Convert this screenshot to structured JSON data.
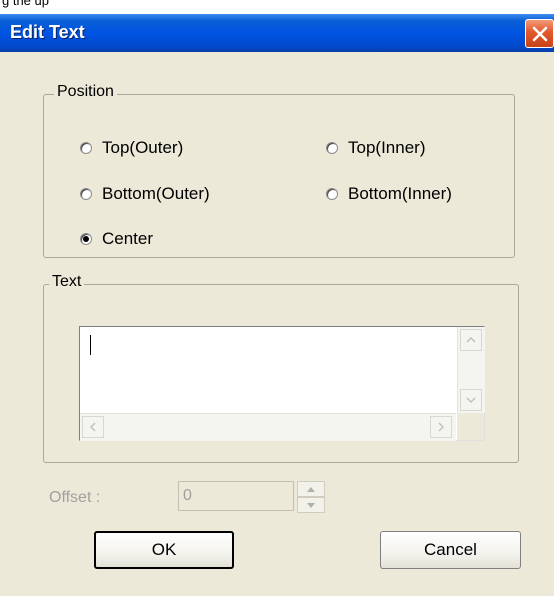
{
  "top_strip": {
    "text": "g the up"
  },
  "window": {
    "title": "Edit Text"
  },
  "position_group": {
    "legend": "Position",
    "options": [
      {
        "label": "Top(Outer)",
        "checked": false
      },
      {
        "label": "Top(Inner)",
        "checked": false
      },
      {
        "label": "Bottom(Outer)",
        "checked": false
      },
      {
        "label": "Bottom(Inner)",
        "checked": false
      },
      {
        "label": "Center",
        "checked": true
      }
    ]
  },
  "text_group": {
    "legend": "Text",
    "value": ""
  },
  "offset": {
    "label": "Offset :",
    "value": "0",
    "enabled": false
  },
  "buttons": {
    "ok": "OK",
    "cancel": "Cancel"
  },
  "icons": {
    "close": "close-icon",
    "scroll_up": "arrow-up-icon",
    "scroll_down": "arrow-down-icon",
    "scroll_left": "arrow-left-icon",
    "scroll_right": "arrow-right-icon"
  },
  "colors": {
    "titlebar": "#0054e3",
    "dialog_bg": "#ece9d8",
    "close_button": "#e2582a",
    "disabled_text": "#a0a0a0"
  }
}
